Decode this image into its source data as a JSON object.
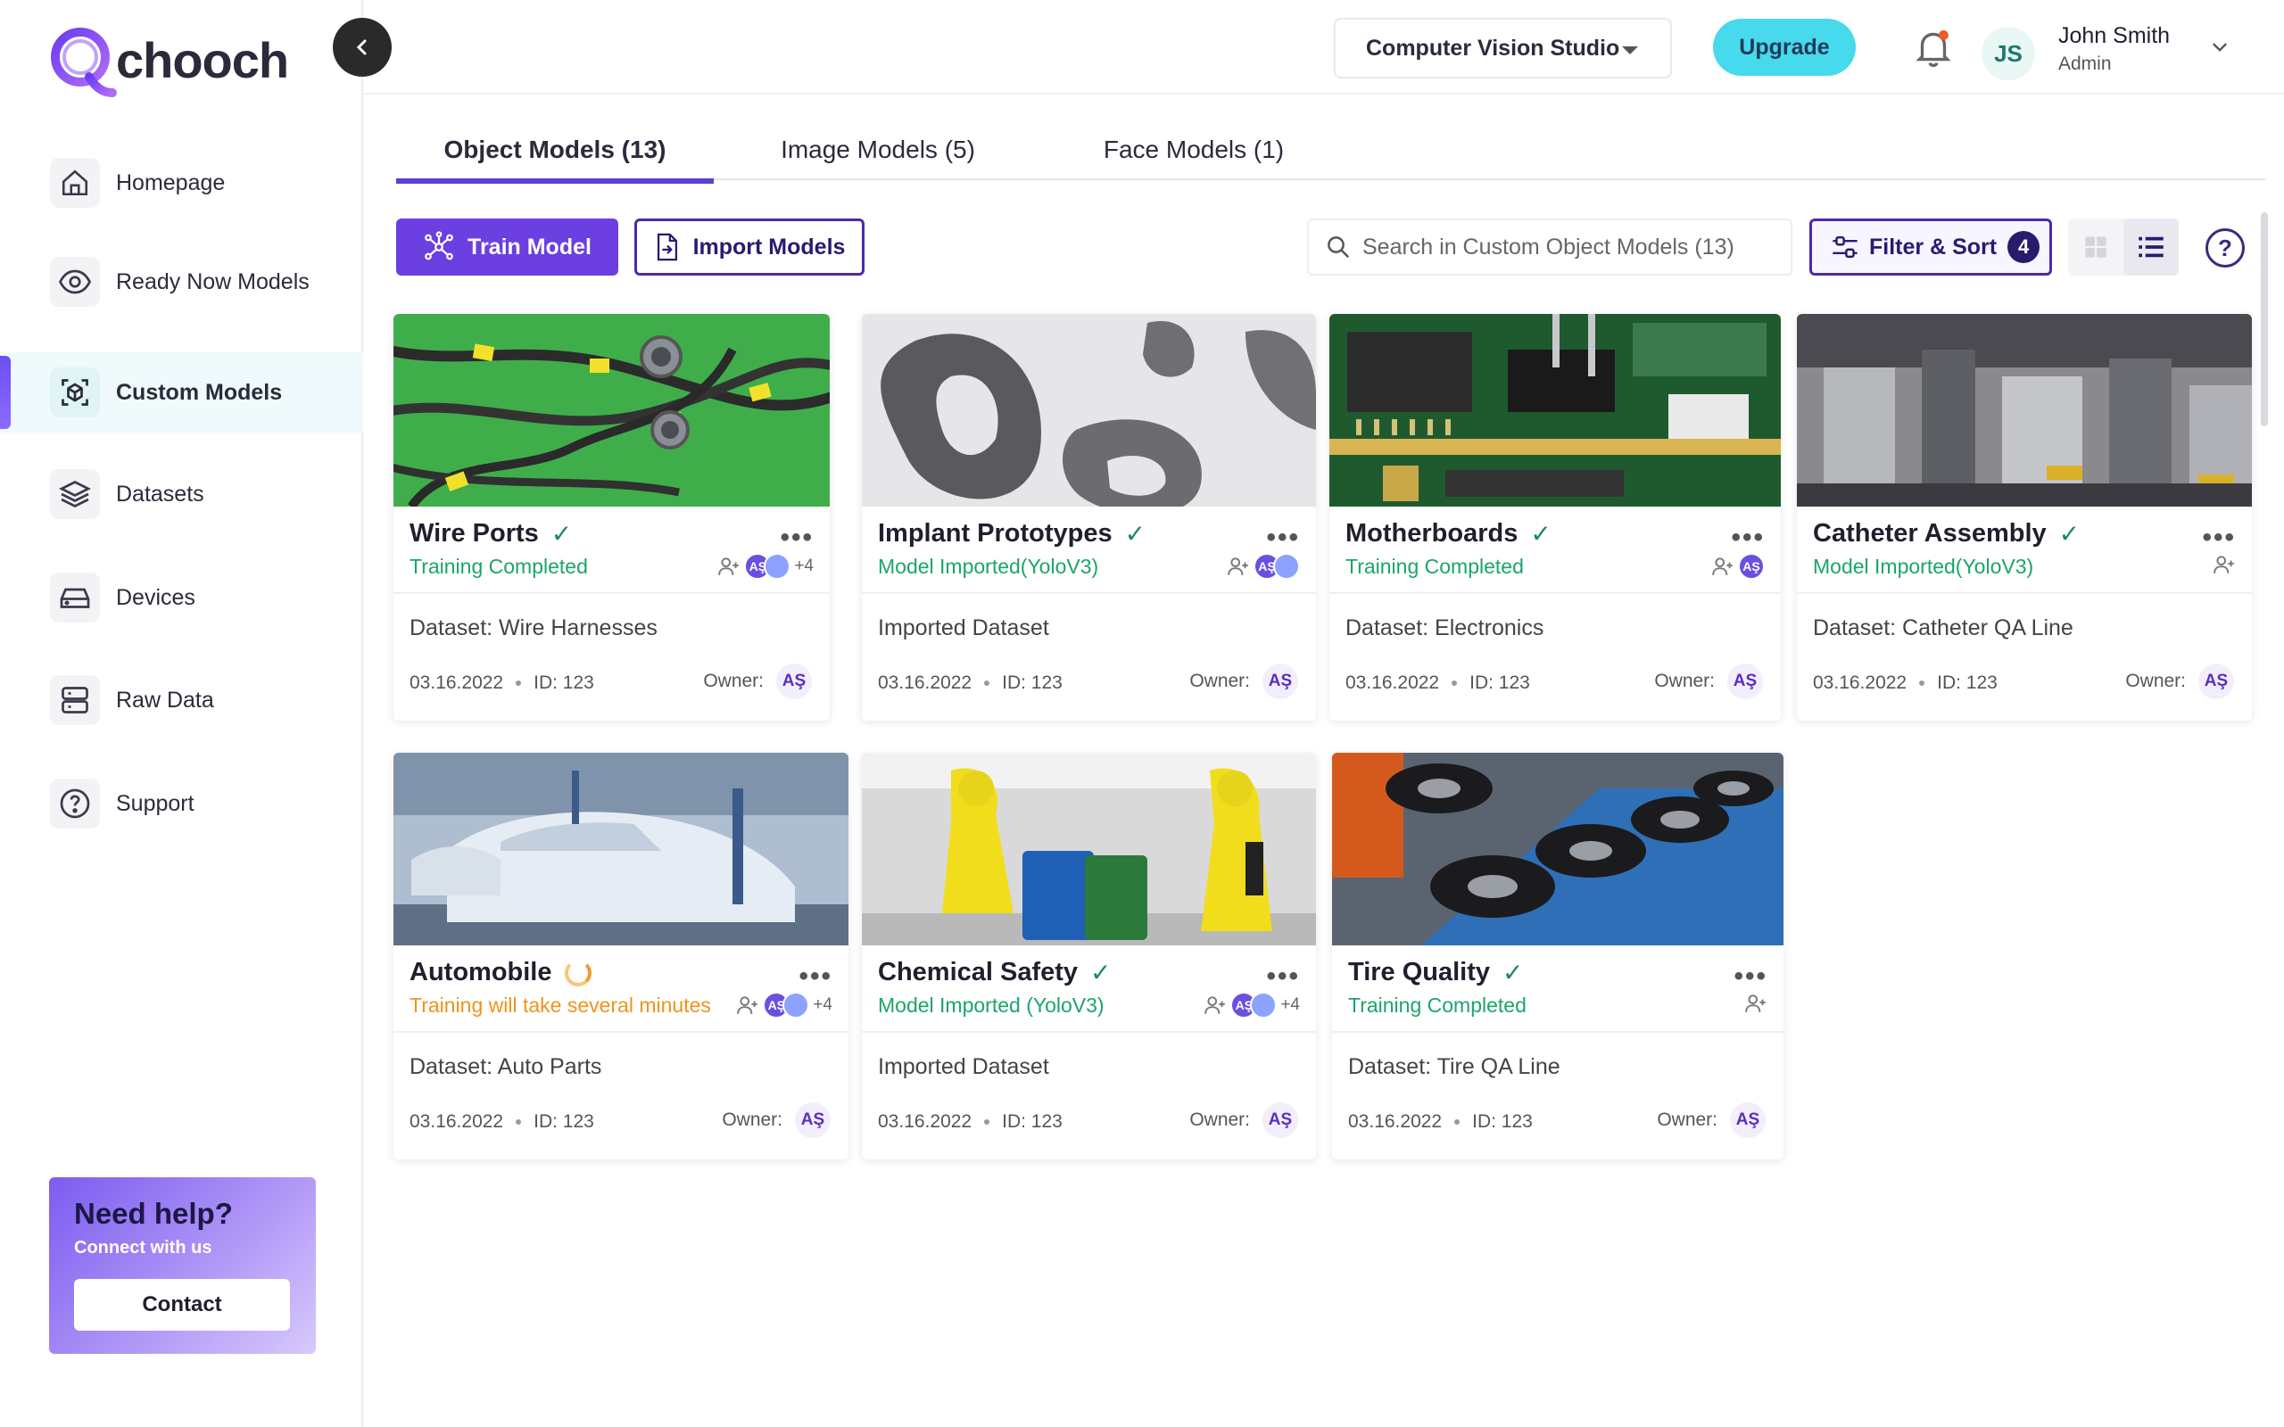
{
  "brand": {
    "name": "chooch"
  },
  "sidebar": {
    "items": [
      {
        "label": "Homepage",
        "icon": "home-icon"
      },
      {
        "label": "Ready Now Models",
        "icon": "eye-icon"
      },
      {
        "label": "Custom Models",
        "icon": "cube-icon",
        "active": true
      },
      {
        "label": "Datasets",
        "icon": "layers-icon"
      },
      {
        "label": "Devices",
        "icon": "device-icon"
      },
      {
        "label": "Raw Data",
        "icon": "server-icon"
      },
      {
        "label": "Support",
        "icon": "question-icon"
      }
    ],
    "help": {
      "title": "Need help?",
      "subtitle": "Connect with us",
      "button": "Contact"
    }
  },
  "header": {
    "studio": "Computer Vision Studio",
    "upgrade": "Upgrade",
    "user": {
      "initials": "JS",
      "name": "John Smith",
      "role": "Admin"
    }
  },
  "tabs": [
    {
      "label": "Object Models (13)",
      "active": true
    },
    {
      "label": "Image Models (5)"
    },
    {
      "label": "Face Models (1)"
    }
  ],
  "toolbar": {
    "train": "Train Model",
    "import": "Import Models",
    "search_placeholder": "Search in Custom Object Models (13)",
    "filter": "Filter & Sort",
    "filter_count": "4"
  },
  "cards": [
    {
      "title": "Wire Ports",
      "state": "done",
      "status": "Training Completed",
      "status_color": "#1ba56a",
      "share": "+4",
      "dataset": "Dataset: Wire Harnesses",
      "date": "03.16.2022",
      "id": "ID: 123",
      "owner_label": "Owner:",
      "owner": "AŞ",
      "share_initials": "AŞ"
    },
    {
      "title": "Implant Prototypes",
      "state": "done",
      "status": "Model Imported(YoloV3)",
      "status_color": "#1ba56a",
      "share": "",
      "dataset": "Imported Dataset",
      "date": "03.16.2022",
      "id": "ID: 123",
      "owner_label": "Owner:",
      "owner": "AŞ",
      "share_initials": "AŞ"
    },
    {
      "title": "Motherboards",
      "state": "done",
      "status": "Training Completed",
      "status_color": "#1ba56a",
      "share": "",
      "dataset": "Dataset: Electronics",
      "date": "03.16.2022",
      "id": "ID: 123",
      "owner_label": "Owner:",
      "owner": "AŞ",
      "share_initials": "AŞ"
    },
    {
      "title": "Catheter Assembly",
      "state": "done",
      "status": "Model Imported(YoloV3)",
      "status_color": "#1ba56a",
      "share": "",
      "dataset": "Dataset: Catheter QA Line",
      "date": "03.16.2022",
      "id": "ID: 123",
      "owner_label": "Owner:",
      "owner": "AŞ",
      "share_initials": ""
    },
    {
      "title": "Automobile",
      "state": "training",
      "status": "Training will take several minutes",
      "status_color": "#f0941b",
      "share": "+4",
      "dataset": "Dataset: Auto Parts",
      "date": "03.16.2022",
      "id": "ID: 123",
      "owner_label": "Owner:",
      "owner": "AŞ",
      "share_initials": "AŞ"
    },
    {
      "title": "Chemical Safety",
      "state": "done",
      "status": "Model Imported (YoloV3)",
      "status_color": "#1ba56a",
      "share": "+4",
      "dataset": "Imported Dataset",
      "date": "03.16.2022",
      "id": "ID: 123",
      "owner_label": "Owner:",
      "owner": "AŞ",
      "share_initials": "AŞ"
    },
    {
      "title": "Tire Quality",
      "state": "done",
      "status": "Training Completed",
      "status_color": "#1ba56a",
      "share": "",
      "dataset": "Dataset: Tire QA Line",
      "date": "03.16.2022",
      "id": "ID: 123",
      "owner_label": "Owner:",
      "owner": "AŞ",
      "share_initials": ""
    }
  ]
}
